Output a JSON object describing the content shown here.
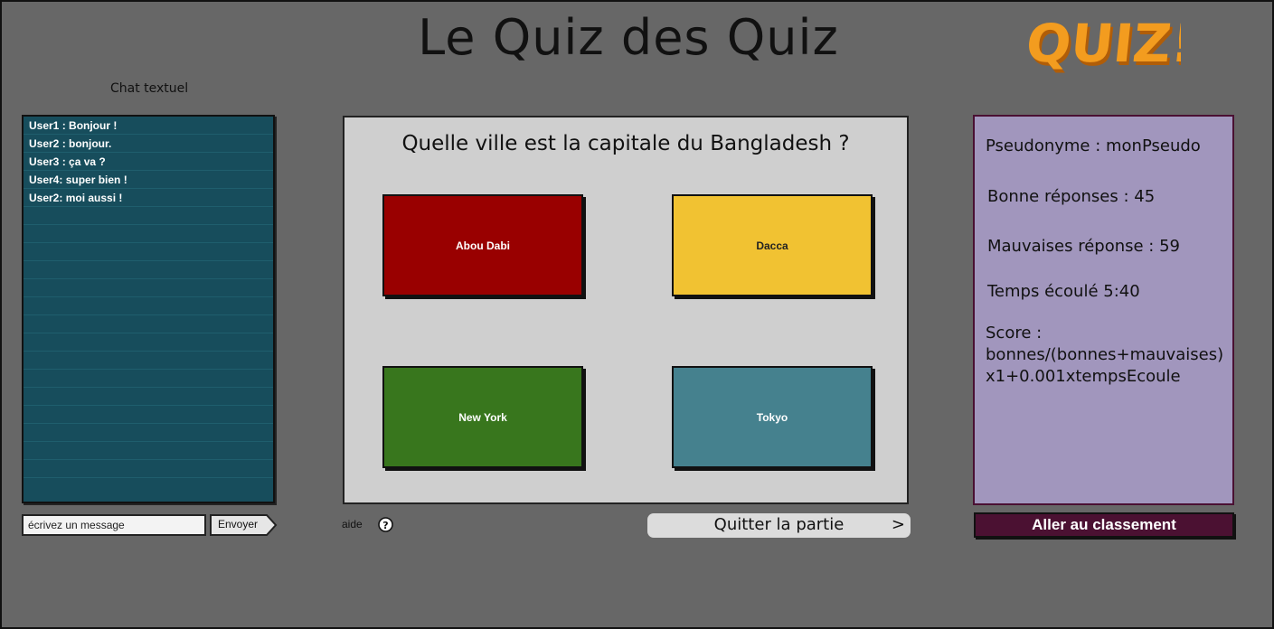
{
  "header": {
    "title": "Le Quiz des Quiz",
    "logo_text": "QUIZ!"
  },
  "chat": {
    "label": "Chat textuel",
    "messages": [
      "User1 : Bonjour !",
      "User2 : bonjour.",
      "User3 : ça va ?",
      "User4: super bien !",
      "User2: moi aussi !"
    ],
    "input_placeholder": "écrivez un message",
    "send_label": "Envoyer"
  },
  "quiz": {
    "question": "Quelle ville est la capitale du Bangladesh ?",
    "answers": [
      {
        "label": "Abou Dabi",
        "color": "#990000",
        "text_color": "#ffffff"
      },
      {
        "label": "Dacca",
        "color": "#f1c232",
        "text_color": "#222222"
      },
      {
        "label": "New York",
        "color": "#38761d",
        "text_color": "#ffffff"
      },
      {
        "label": "Tokyo",
        "color": "#45818e",
        "text_color": "#ffffff"
      }
    ],
    "help_label": "aide",
    "quit_label": "Quitter la partie",
    "quit_chevron": ">"
  },
  "stats": {
    "pseudo": "Pseudonyme : monPseudo",
    "good": "Bonne réponses : 45",
    "bad": "Mauvaises réponse : 59",
    "time": "Temps écoulé 5:40",
    "score_line1": "Score :",
    "score_line2": "bonnes/(bonnes+mauvaises)",
    "score_line3": "x1+0.001xtempsEcoule"
  },
  "ranking_button": "Aller au classement",
  "colors": {
    "background": "#676767",
    "chat_panel": "#174d5c",
    "stats_panel": "#a196bd",
    "accent_dark": "#4b1132",
    "logo": "#f39c1f"
  }
}
